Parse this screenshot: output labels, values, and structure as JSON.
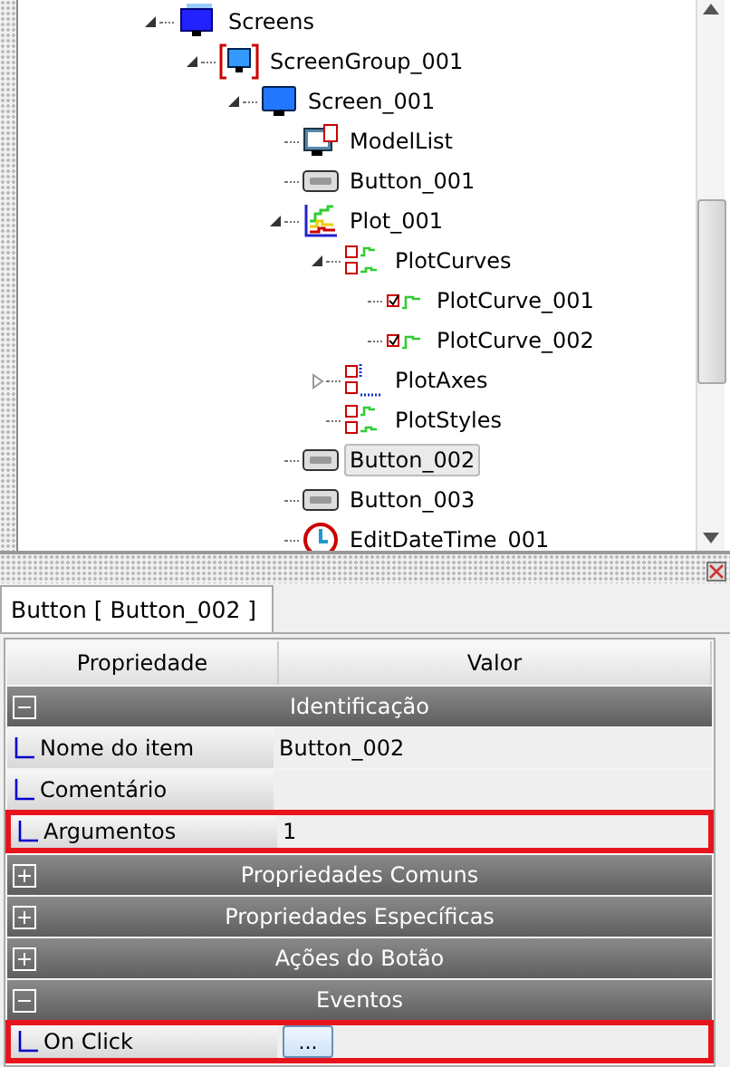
{
  "tree": {
    "items": [
      {
        "label": "Screens",
        "kind": "screens",
        "expanded": true,
        "selected": false,
        "children": [
          {
            "label": "ScreenGroup_001",
            "kind": "screen-group",
            "expanded": true,
            "selected": false,
            "children": [
              {
                "label": "Screen_001",
                "kind": "screen",
                "expanded": true,
                "selected": false,
                "children": [
                  {
                    "label": "ModelList",
                    "kind": "model-list",
                    "selected": false
                  },
                  {
                    "label": "Button_001",
                    "kind": "button",
                    "selected": false
                  },
                  {
                    "label": "Plot_001",
                    "kind": "plot",
                    "expanded": true,
                    "selected": false,
                    "children": [
                      {
                        "label": "PlotCurves",
                        "kind": "plot-set",
                        "expanded": true,
                        "selected": false,
                        "children": [
                          {
                            "label": "PlotCurve_001",
                            "kind": "plot-curve",
                            "selected": false
                          },
                          {
                            "label": "PlotCurve_002",
                            "kind": "plot-curve",
                            "selected": false
                          }
                        ]
                      },
                      {
                        "label": "PlotAxes",
                        "kind": "plot-axes",
                        "expanded": false,
                        "selected": false
                      },
                      {
                        "label": "PlotStyles",
                        "kind": "plot-set",
                        "selected": false
                      }
                    ]
                  },
                  {
                    "label": "Button_002",
                    "kind": "button",
                    "selected": true
                  },
                  {
                    "label": "Button_003",
                    "kind": "button",
                    "selected": false
                  },
                  {
                    "label": "EditDateTime_001",
                    "kind": "clock",
                    "selected": false
                  }
                ]
              }
            ]
          }
        ]
      }
    ]
  },
  "panel": {
    "tab": "Button [ Button_002 ]",
    "columns": [
      "Propriedade",
      "Valor"
    ],
    "groups": [
      {
        "title": "Identificação",
        "expanded": true,
        "rows": [
          {
            "name": "Nome do item",
            "value": "Button_002",
            "highlighted": false
          },
          {
            "name": "Comentário",
            "highlighted": false
          },
          {
            "name": "Argumentos",
            "value": "1",
            "highlighted": true
          }
        ]
      },
      {
        "title": "Propriedades Comuns",
        "expanded": false
      },
      {
        "title": "Propriedades Específicas",
        "expanded": false
      },
      {
        "title": "Ações do Botão",
        "expanded": false
      },
      {
        "title": "Eventos",
        "expanded": true,
        "rows": [
          {
            "name": "On Click",
            "button": "...",
            "highlighted": true
          }
        ]
      }
    ]
  }
}
